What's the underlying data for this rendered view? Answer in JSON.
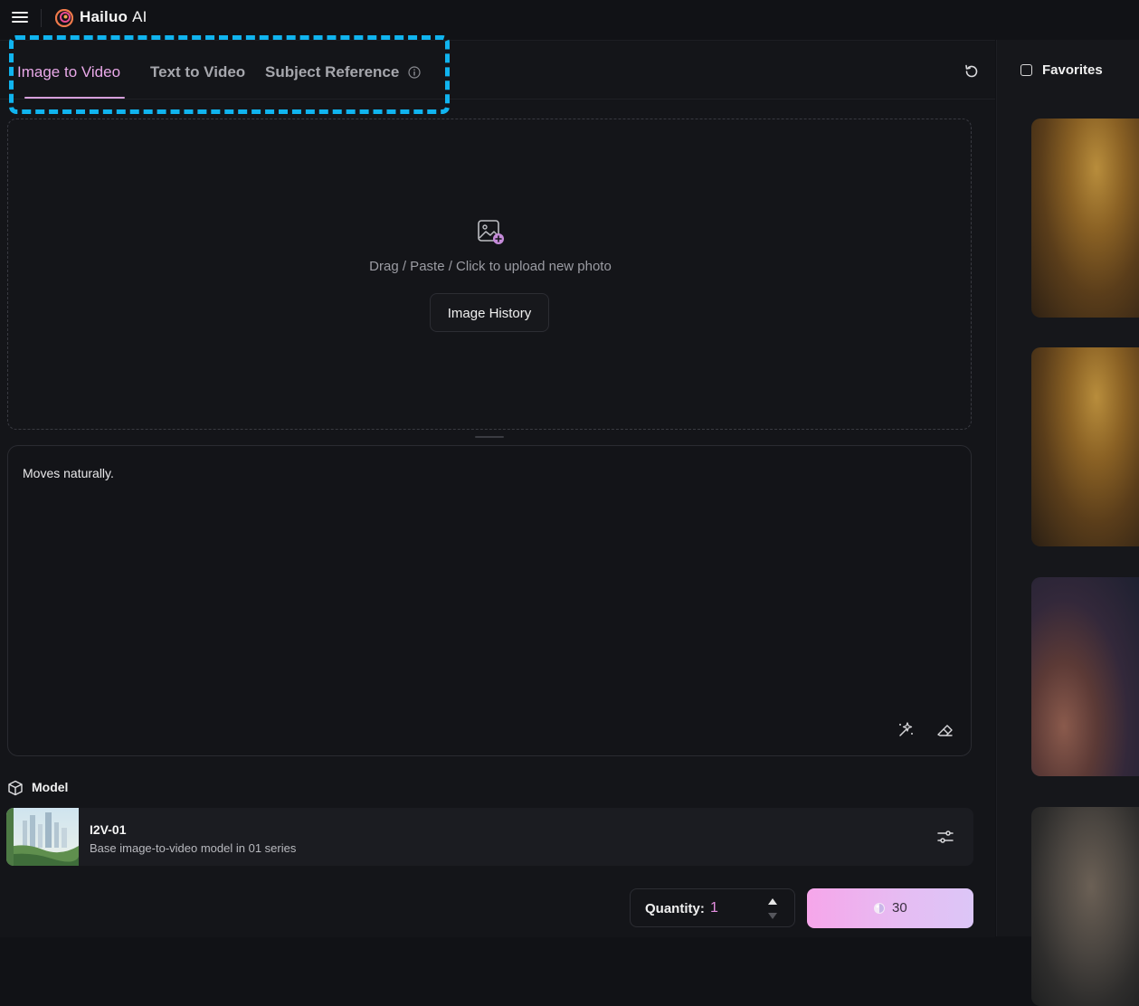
{
  "app": {
    "brand_name": "Hailuo",
    "brand_suffix": "AI"
  },
  "tabs": [
    {
      "label": "Image to Video",
      "active": true
    },
    {
      "label": "Text to Video",
      "active": false
    },
    {
      "label": "Subject Reference",
      "active": false
    }
  ],
  "upload": {
    "hint": "Drag / Paste / Click to upload new photo",
    "history_button": "Image History"
  },
  "prompt": {
    "value": "Moves naturally."
  },
  "model": {
    "section_label": "Model",
    "name": "I2V-01",
    "description": "Base image-to-video model in 01 series"
  },
  "quantity": {
    "label": "Quantity:",
    "value": "1"
  },
  "generate": {
    "cost": "30"
  },
  "sidebar": {
    "favorites_label": "Favorites",
    "favorites_checked": false
  },
  "colors": {
    "accent": "#e9a8e8",
    "highlight_border": "#10b4ef",
    "background": "#141519"
  }
}
